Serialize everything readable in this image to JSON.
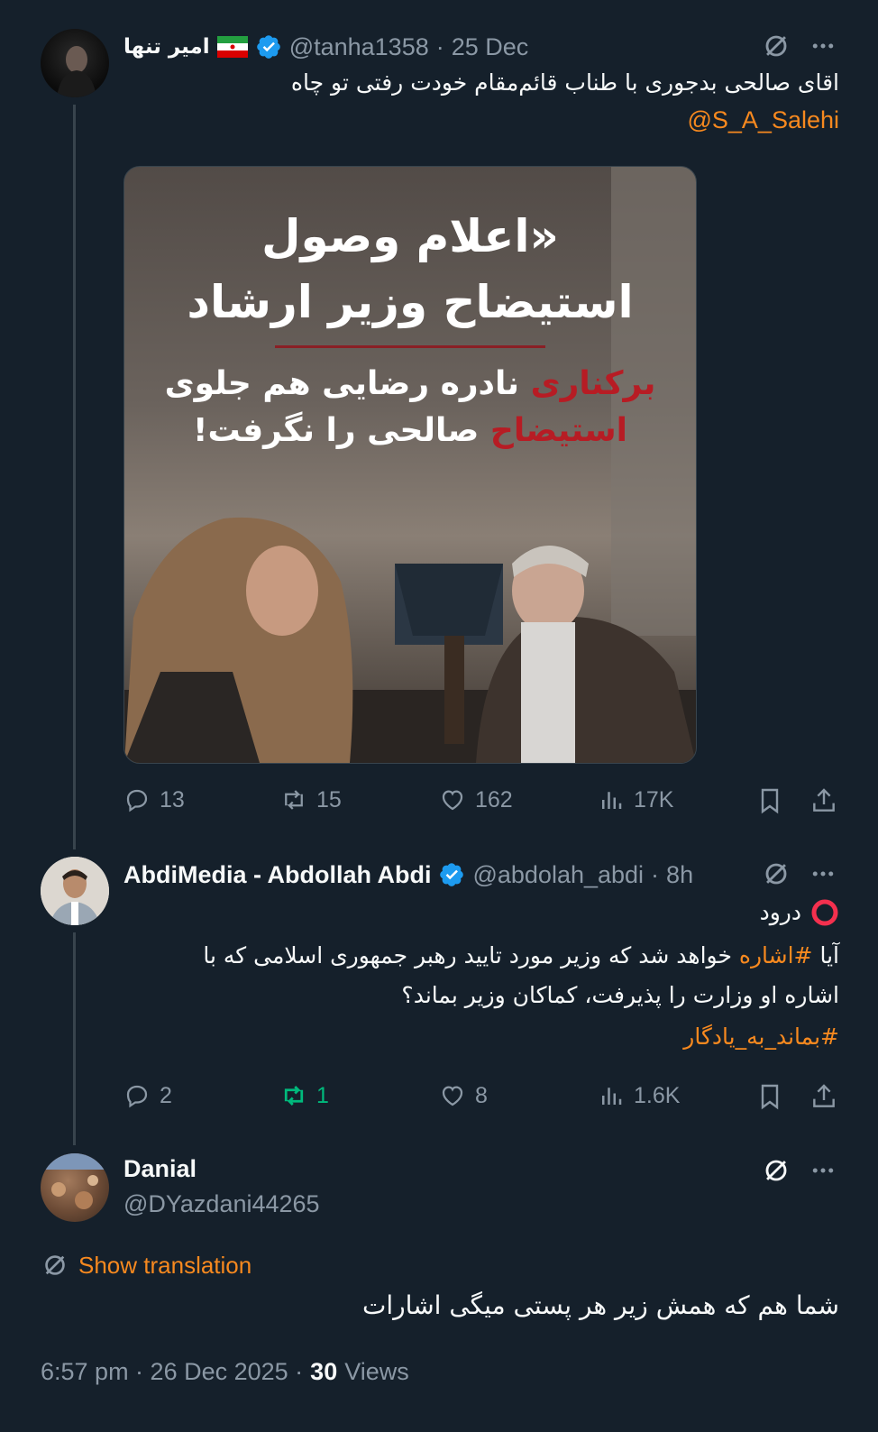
{
  "tweets": [
    {
      "display_name": "امیر تنها",
      "handle": "@tanha1358",
      "sep": "·",
      "date": "25 Dec",
      "text": "اقای صالحی بدجوری با طناب قائم‌مقام خودت رفتی تو چاه",
      "mention": "@S_A_Salehi",
      "image": {
        "headline_1": "«اعلام وصول",
        "headline_2": "استیضاح وزیر ارشاد",
        "sub_1_red": "برکناری",
        "sub_1_white": "نادره رضایی هم جلوی",
        "sub_2_red": "استیضاح",
        "sub_2_white": "صالحی را نگرفت!"
      },
      "actions": {
        "replies": "13",
        "retweets": "15",
        "likes": "162",
        "views": "17K"
      }
    },
    {
      "display_name": "AbdiMedia - Abdollah Abdi",
      "handle": "@abdolah_abdi",
      "sep": "·",
      "date": "8h",
      "greeting": "درود",
      "line1_pre": "آیا",
      "line1_tag": "#اشاره",
      "line1_post": "خواهد شد که وزیر مورد تایید رهبر جمهوری اسلامی که با",
      "line2": "اشاره او وزارت را پذیرفت، کماکان وزیر بماند؟",
      "hashtag": "#بماند_به_یادگار",
      "actions": {
        "replies": "2",
        "retweets": "1",
        "likes": "8",
        "views": "1.6K"
      }
    },
    {
      "display_name": "Danial",
      "handle": "@DYazdani44265",
      "translate_label": "Show translation",
      "text": "شما هم که همش زیر هر پستی میگی اشارات",
      "timestamp": "6:57 pm · 26 Dec 2025 ·",
      "views_count": "30",
      "views_label": "Views"
    }
  ],
  "colors": {
    "bg": "#15202b",
    "accent": "#f7891f",
    "verified": "#1d9bf0",
    "retweet_active": "#00ba7c",
    "muted": "#8b98a5"
  },
  "icons": [
    "grok-icon",
    "more-icon",
    "reply-icon",
    "retweet-icon",
    "like-icon",
    "views-icon",
    "bookmark-icon",
    "share-icon",
    "verified-badge-icon",
    "translate-icon",
    "iran-flag-icon"
  ]
}
